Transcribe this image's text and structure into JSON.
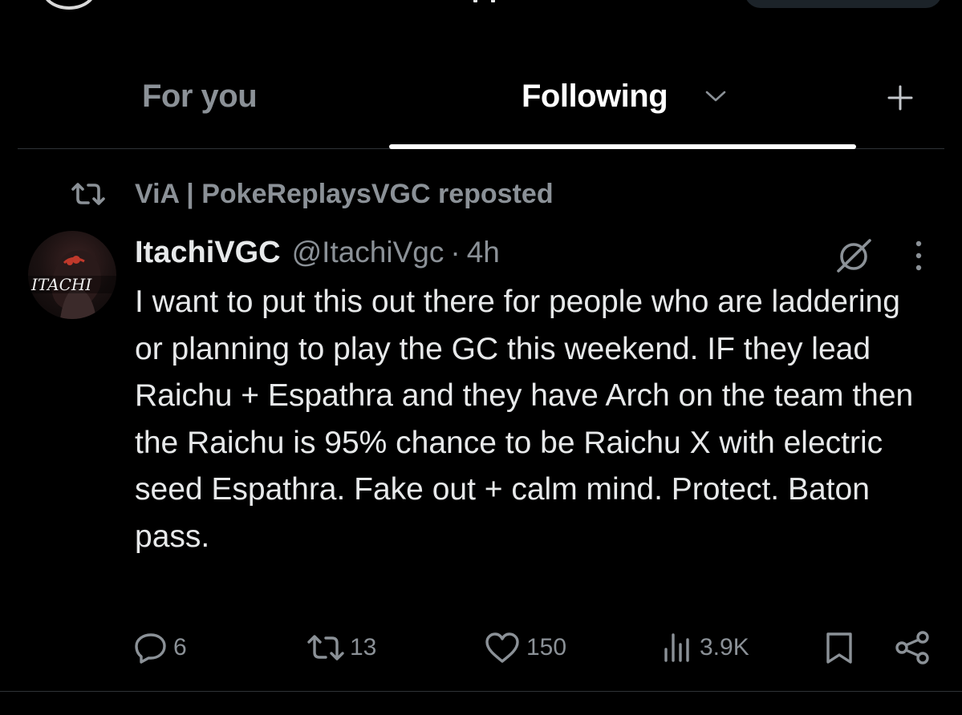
{
  "tabs": [
    {
      "label": "For you",
      "active": false
    },
    {
      "label": "Following",
      "active": true
    }
  ],
  "repost": {
    "text": "ViA | PokeReplaysVGC reposted"
  },
  "tweet": {
    "display_name": "ItachiVGC",
    "handle": "@ItachiVgc",
    "separator": "·",
    "time": "4h",
    "avatar_text": "ITACHI",
    "text": "I want to put this out there for people who are laddering or planning to play the GC this weekend. IF they lead Raichu + Espathra and they have Arch on the team then the Raichu is 95% chance to be Raichu X with electric seed Espathra. Fake out + calm mind. Protect. Baton pass.",
    "actions": {
      "replies": "6",
      "reposts": "13",
      "likes": "150",
      "views": "3.9K"
    }
  },
  "icons": {
    "tab_dropdown": "chevron-down-icon",
    "add": "plus-icon",
    "repost": "repost-icon",
    "grok": "grok-icon",
    "more": "more-vertical-icon",
    "reply": "reply-icon",
    "like": "heart-icon",
    "views": "views-icon",
    "bookmark": "bookmark-icon",
    "share": "share-icon"
  },
  "colors": {
    "background": "#000000",
    "primary_text": "#e7e9ea",
    "secondary_text": "#8b9197",
    "divider": "#2f3336",
    "tab_indicator": "#ffffff"
  }
}
